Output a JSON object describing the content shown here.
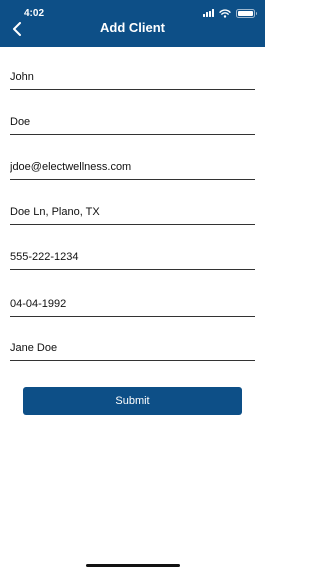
{
  "status_bar": {
    "time": "4:02",
    "icons": [
      "signal-icon",
      "wifi-icon",
      "battery-icon"
    ]
  },
  "header": {
    "title": "Add Client",
    "back_icon": "chevron-left-icon",
    "background": "#0d4f87"
  },
  "form": {
    "fields": [
      {
        "name": "first-name-field",
        "value": "John"
      },
      {
        "name": "last-name-field",
        "value": "Doe"
      },
      {
        "name": "email-field",
        "value": "jdoe@electwellness.com"
      },
      {
        "name": "address-field",
        "value": "Doe Ln, Plano, TX"
      },
      {
        "name": "phone-field",
        "value": "555-222-1234"
      },
      {
        "name": "dob-field",
        "value": "04-04-1992"
      },
      {
        "name": "contact-name-field",
        "value": "Jane Doe"
      }
    ]
  },
  "submit": {
    "label": "Submit",
    "color": "#0d4f87"
  }
}
